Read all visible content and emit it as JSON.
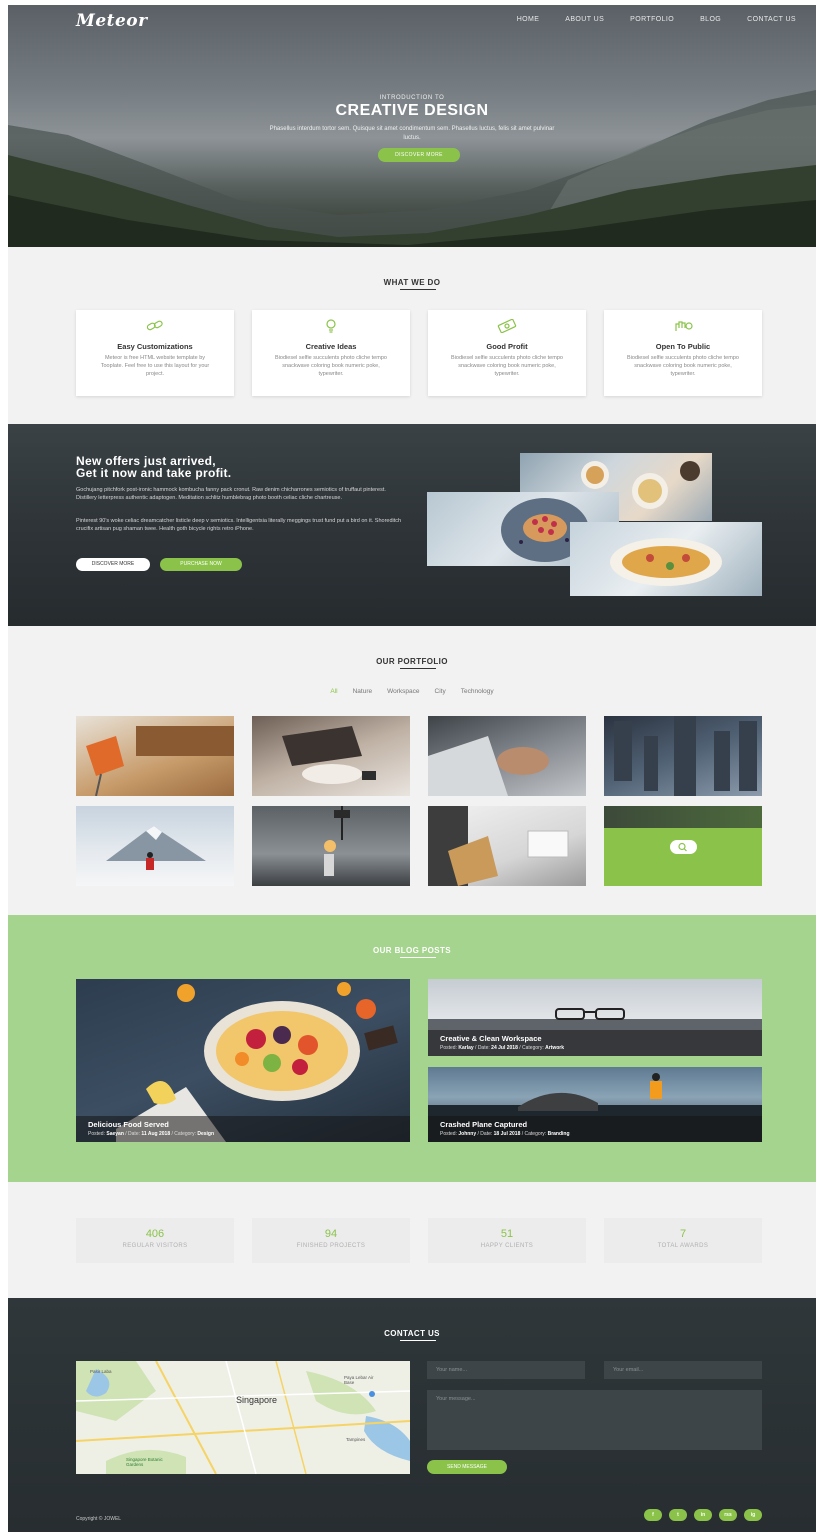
{
  "header": {
    "logo": "Meteor",
    "nav": [
      "HOME",
      "ABOUT US",
      "PORTFOLIO",
      "BLOG",
      "CONTACT US"
    ]
  },
  "hero": {
    "intro": "INTRODUCTION TO",
    "title": "CREATIVE DESIGN",
    "text": "Phasellus interdum tortor sem. Quisque sit amet condimentum sem. Phasellus luctus, felis sit amet pulvinar luctus.",
    "button": "DISCOVER MORE"
  },
  "what_we_do": {
    "title": "WHAT WE DO",
    "cards": [
      {
        "icon": "link-icon",
        "title": "Easy Customizations",
        "text": "Meteor is free HTML website template by Tooplate. Feel free to use this layout for your project."
      },
      {
        "icon": "lightbulb-icon",
        "title": "Creative Ideas",
        "text": "Biodiesel selfie succulents photo cliche tempo snackwave coloring book numeric poke, typewriter."
      },
      {
        "icon": "money-icon",
        "title": "Good Profit",
        "text": "Biodiesel selfie succulents photo cliche tempo snackwave coloring book numeric poke, typewriter."
      },
      {
        "icon": "hand-icon",
        "title": "Open To Public",
        "text": "Biodiesel selfie succulents photo cliche tempo snackwave coloring book numeric poke, typewriter."
      }
    ]
  },
  "offers": {
    "heading_line1": "New offers just arrived,",
    "heading_line2": "Get it now and take profit.",
    "para1": "Gochujang pitchfork post-ironic hammock kombucha fanny pack cronut. Raw denim chicharrones semiotics of truffaut pinterest. Distillery letterpress authentic adaptogen. Meditation schlitz humblebrag photo booth celiac cliche chartreuse.",
    "para2": "Pinterest 90's woke celiac dreamcatcher listicle deep v semiotics. Intelligentsia literally meggings trust fund put a bird on it. Shoreditch crucifix artisan pug shaman twee. Health goth bicycle rights retro iPhone.",
    "button_discover": "DISCOVER MORE",
    "button_purchase": "PURCHASE NOW"
  },
  "portfolio": {
    "title": "OUR PORTFOLIO",
    "filters": [
      "All",
      "Nature",
      "Workspace",
      "City",
      "Technology"
    ],
    "active_filter": "All"
  },
  "blog": {
    "title": "OUR BLOG POSTS",
    "posts": [
      {
        "title": "Delicious Food Served",
        "posted_label": "Posted:",
        "author": "Saeyan",
        "date_label": "/ Date:",
        "date": "11 Aug 2018",
        "category_label": "/ Category:",
        "category": "Design"
      },
      {
        "title": "Creative & Clean Workspace",
        "posted_label": "Posted:",
        "author": "Karlay",
        "date_label": "/ Date:",
        "date": "24 Jul 2018",
        "category_label": "/ Category:",
        "category": "Artwork"
      },
      {
        "title": "Crashed Plane Captured",
        "posted_label": "Posted:",
        "author": "Johnny",
        "date_label": "/ Date:",
        "date": "18 Jul 2018",
        "category_label": "/ Category:",
        "category": "Branding"
      }
    ]
  },
  "stats": [
    {
      "number": "406",
      "label": "REGULAR VISITORS"
    },
    {
      "number": "94",
      "label": "FINISHED PROJECTS"
    },
    {
      "number": "51",
      "label": "HAPPY CLIENTS"
    },
    {
      "number": "7",
      "label": "TOTAL AWARDS"
    }
  ],
  "contact": {
    "title": "CONTACT US",
    "map_label": "Singapore",
    "map_places": [
      "Pasir Laba",
      "Singapore Botanic Gardens",
      "Paya Lebar Air Base",
      "Tampines"
    ],
    "name_placeholder": "Your name...",
    "email_placeholder": "Your email...",
    "message_placeholder": "Your message...",
    "send_button": "SEND MESSAGE",
    "copyright": "Copyright © JOWEL",
    "socials": [
      "f",
      "t",
      "in",
      "rss",
      "ig"
    ]
  },
  "colors": {
    "accent": "#8bc34a",
    "blog_bg": "#a5d48e",
    "dark_bg": "#2f373a"
  }
}
